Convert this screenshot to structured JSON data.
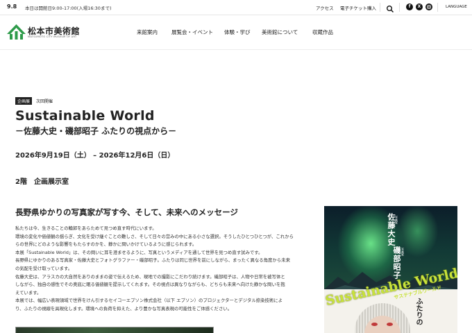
{
  "topbar": {
    "date": "9.8",
    "hours": "本日は開館日9:00-17:00(入場16:30まで)",
    "access": "アクセス",
    "e_ticket": "電子チケット購入",
    "language": "LANGUAGE",
    "icons": [
      "search-icon",
      "facebook-icon",
      "x-icon",
      "instagram-icon"
    ]
  },
  "header": {
    "logo_title": "松本市美術館",
    "logo_sub": "MATSUMOTO CITY MUSEUM OF ART",
    "nav": [
      "来館案内",
      "展覧会・イベント",
      "体験・学び",
      "美術館について",
      "収蔵作品"
    ]
  },
  "exhibition": {
    "badge": "企画展",
    "status": "次回開催",
    "title": "Sustainable World",
    "subtitle": "－佐藤大史・磯部昭子 ふたりの視点から－",
    "dates": "2026年9月19日（土） – 2026年12月6日（日）",
    "venue": "2階　企画展示室"
  },
  "intro": {
    "heading": "長野県ゆかりの写真家が写す今、そして、未来へのメッセージ",
    "paragraphs": [
      "私たちは今、生きることの輪郭をあらためて見つめ直す時代にいます。",
      "環境の変化や価値観の揺らぎ、文化を受け継ぐことの難しさ、そして日々の営みの中にある小さな選択。そうしたひとつひとつが、これから",
      "らの世界にどのような影響をもたらすのかを、静かに問いかけているように感じられます。",
      "本展「Sustainable World」は、その問いに耳を澄ませるように、写真というメディアを通して世界を見つめ直す試みです。",
      "長野県にゆかりのある写真家・佐藤大史とフォトグラファー・磯部昭子。ふたりは同じ世界を前にしながら、まったく異なる角度から未来",
      "の気配を受け取っています。",
      "佐藤大史は、アラスカの大自然をありのままの姿で伝えるため、現地での撮影にこだわり続けます。磯部昭子は、人物や日常を被写体と",
      "しながら、独自の感性でその奥底に眠る価値観を提示してくれます。その視点は異なりながらも、どちらも未来へ向けた静かな問いを抱",
      "えています。",
      "本展では、幅広い表現領域で世界をけん引するセイコーエプソン株式会社（以下 エプソン）のプロジェクターとデジタル捺染技術によ",
      "り、ふたりの視線を具現化します。環境への負荷を抑えた、より豊かな写真表現の可能性をご体感ください。"
    ]
  },
  "poster": {
    "artist_1": "佐藤大史",
    "artist_2": "磯部昭子",
    "artist_label": "写真家",
    "logo": "Sustainable World",
    "logo_kana": "サステナブルワールド",
    "vertical_title": "ふたりの"
  },
  "colors": {
    "brand_green": "#2e9b4a",
    "poster_accent": "#c8e23a"
  }
}
